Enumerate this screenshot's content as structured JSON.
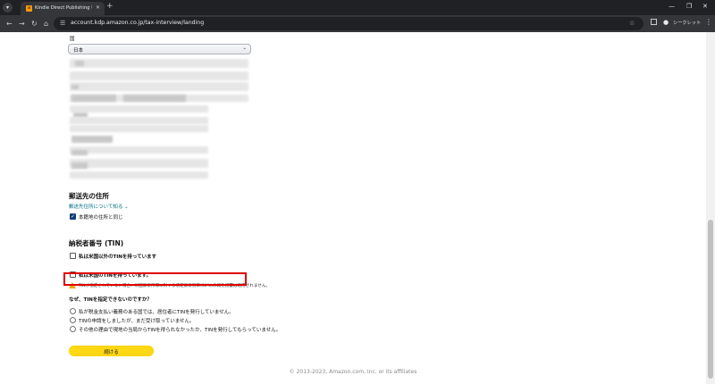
{
  "browser": {
    "tab_title": "Kindle Direct Publishing 税務イ",
    "url": "account.kdp.amazon.co.jp/tax-interview/landing",
    "incognito_label": "シークレット"
  },
  "address": {
    "country_label": "国",
    "country_value": "日本"
  },
  "mailing": {
    "heading": "郵送先の住所",
    "about_link": "郵送先住所について知る",
    "same_as_residence_label": "本籍地の住所と同じ"
  },
  "tin": {
    "heading": "納税者番号 (TIN)",
    "foreign_tin_label": "私は米国以外のTINを持っています",
    "us_tin_label": "私は米国のTINを持っています。",
    "warning_note": "TINが指定されていない場合、米国源泉所得に対する法定源泉税率(30%)の減免措置は適用されません。",
    "why_question": "なぜ、TINを指定できないのですか？",
    "reasons": [
      "私が税金支払い義務のある国では、居住者にTINを発行していません。",
      "TINの申請をしましたが、まだ受け取っていません。",
      "その他の理由で現地の当局からTINを得られなかったか、TINを発行してもらっていません。"
    ]
  },
  "actions": {
    "continue_label": "続ける"
  },
  "footer": {
    "copyright": "© 2013-2023, Amazon.com, Inc. or its affiliates"
  },
  "colors": {
    "link": "#007185",
    "button": "#ffd814",
    "highlight": "#e00000",
    "checkbox_checked": "#0f3f7a",
    "warning": "#e8a900"
  }
}
